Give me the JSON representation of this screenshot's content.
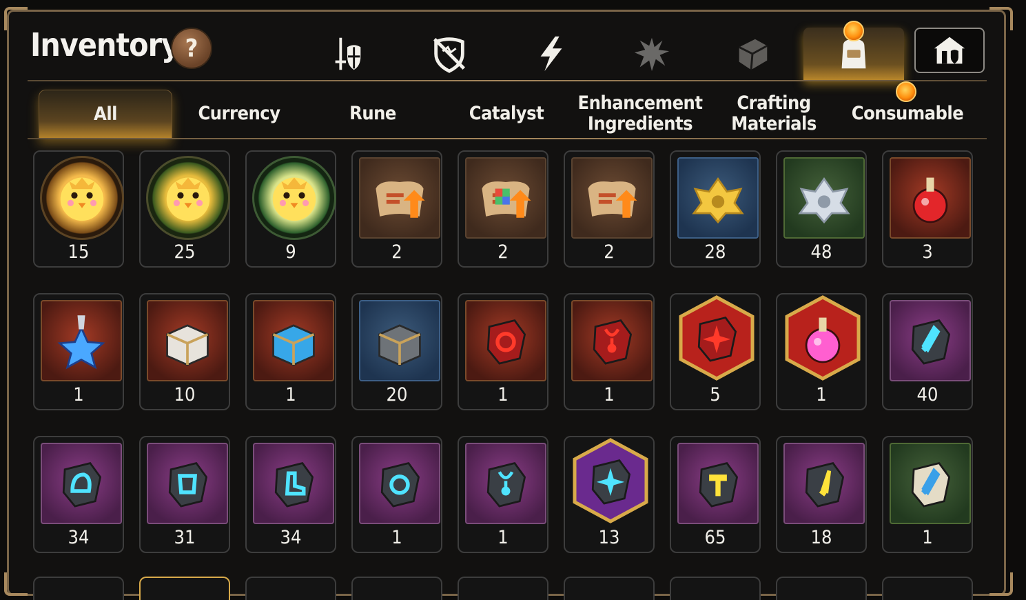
{
  "header": {
    "title": "Inventory",
    "help_label": "?"
  },
  "category_tabs": [
    {
      "name": "equipment-tab",
      "icon": "sword-shield-icon"
    },
    {
      "name": "broken-shield-tab",
      "icon": "broken-shield-icon"
    },
    {
      "name": "lightning-tab",
      "icon": "lightning-icon"
    },
    {
      "name": "splatter-tab",
      "icon": "splatter-icon"
    },
    {
      "name": "cube-tab",
      "icon": "cube-icon"
    },
    {
      "name": "bag-tab",
      "icon": "backpack-icon",
      "active": true
    },
    {
      "name": "house-tab",
      "icon": "house-icon"
    }
  ],
  "sub_tabs": {
    "all": "All",
    "currency": "Currency",
    "rune": "Rune",
    "catalyst": "Catalyst",
    "enhancement": "Enhancement Ingredients",
    "crafting": "Crafting Materials",
    "consumable": "Consumable",
    "active": "All"
  },
  "items": [
    [
      {
        "icon": "golden-chick-token-icon",
        "qty": "15",
        "style": "ring"
      },
      {
        "icon": "green-chick-token-icon",
        "qty": "25",
        "style": "ring-green"
      },
      {
        "icon": "leaf-chick-token-icon",
        "qty": "9",
        "style": "ring-leaf"
      },
      {
        "icon": "upgrade-scroll-icon",
        "qty": "2",
        "style": "brown"
      },
      {
        "icon": "rainbow-upgrade-scroll-icon",
        "qty": "2",
        "style": "brown"
      },
      {
        "icon": "upgrade-scroll-icon",
        "qty": "2",
        "style": "brown"
      },
      {
        "icon": "gold-crystal-cluster-icon",
        "qty": "28",
        "style": "blue"
      },
      {
        "icon": "silver-crystal-cluster-icon",
        "qty": "48",
        "style": "green"
      },
      {
        "icon": "red-potion-icon",
        "qty": "3",
        "style": "red"
      }
    ],
    [
      {
        "icon": "star-potion-icon",
        "qty": "1",
        "style": "red"
      },
      {
        "icon": "white-chest-icon",
        "qty": "10",
        "style": "red"
      },
      {
        "icon": "blue-chest-icon",
        "qty": "1",
        "style": "red"
      },
      {
        "icon": "silver-chest-icon",
        "qty": "20",
        "style": "blue"
      },
      {
        "icon": "red-ring-rune-icon",
        "qty": "1",
        "style": "red"
      },
      {
        "icon": "red-amulet-rune-icon",
        "qty": "1",
        "style": "red"
      },
      {
        "icon": "red-star-rune-hex-icon",
        "qty": "5",
        "style": "hex-red"
      },
      {
        "icon": "pink-potion-hex-icon",
        "qty": "1",
        "style": "hex-red"
      },
      {
        "icon": "cyan-sword-rune-icon",
        "qty": "40",
        "style": "purple"
      }
    ],
    [
      {
        "icon": "cyan-helmet-rune-icon",
        "qty": "34",
        "style": "purple"
      },
      {
        "icon": "cyan-armor-rune-icon",
        "qty": "31",
        "style": "purple"
      },
      {
        "icon": "cyan-boot-rune-icon",
        "qty": "34",
        "style": "purple"
      },
      {
        "icon": "cyan-ring-rune-icon",
        "qty": "1",
        "style": "purple"
      },
      {
        "icon": "cyan-amulet-rune-icon",
        "qty": "1",
        "style": "purple"
      },
      {
        "icon": "cyan-star-rune-hex-icon",
        "qty": "13",
        "style": "hex-purple"
      },
      {
        "icon": "gold-hammer-rune-icon",
        "qty": "65",
        "style": "purple"
      },
      {
        "icon": "gold-dagger-rune-icon",
        "qty": "18",
        "style": "purple"
      },
      {
        "icon": "stone-sword-rune-icon",
        "qty": "1",
        "style": "green"
      }
    ]
  ],
  "colors": {
    "accent_gold": "#b8862b",
    "frame": "#7a6548",
    "notification": "#ff8f0e",
    "rune_glow": "#4fe3ff"
  }
}
